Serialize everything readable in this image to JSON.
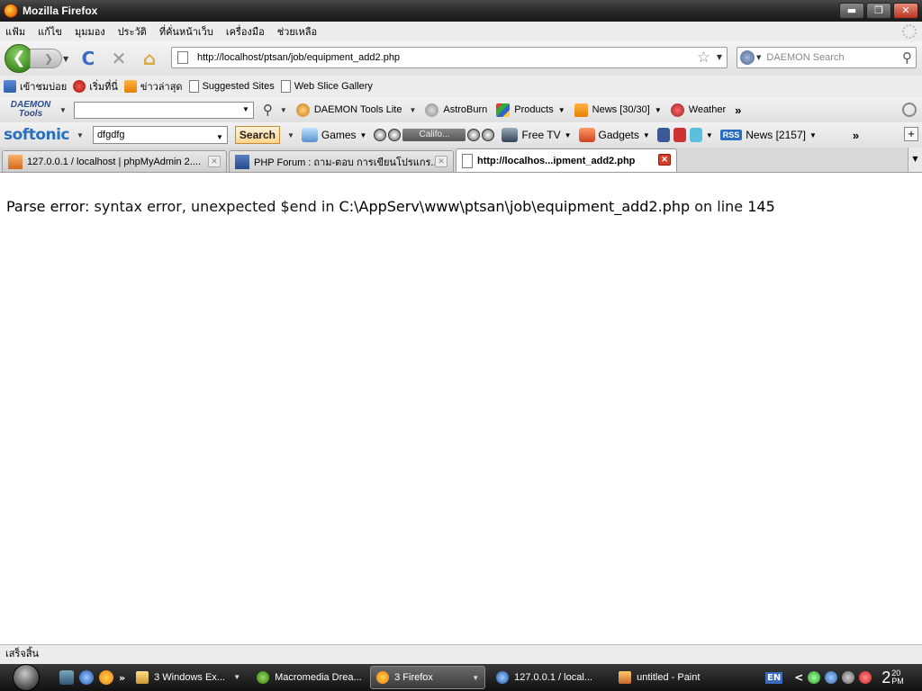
{
  "window": {
    "title": "Mozilla Firefox",
    "min_glyph": "▬",
    "max_glyph": "❐",
    "close_glyph": "✕"
  },
  "menubar": {
    "items": [
      "แฟ้ม",
      "แก้ไข",
      "มุมมอง",
      "ประวัติ",
      "ที่คั่นหน้าเว็บ",
      "เครื่องมือ",
      "ช่วยเหลือ"
    ]
  },
  "navbar": {
    "back_glyph": "❮",
    "forward_glyph": "❯",
    "reload_glyph": "C",
    "stop_glyph": "✕",
    "home_glyph": "⌂",
    "url": "http://localhost/ptsan/job/equipment_add2.php",
    "star_glyph": "☆",
    "search_placeholder": "DAEMON Search",
    "magnifier_glyph": "⚲"
  },
  "bookmarks": {
    "items": [
      {
        "label": "เข้าชมบ่อย",
        "icon": "most-visited-icon"
      },
      {
        "label": "เริ่มที่นี่",
        "icon": "getting-started-icon"
      },
      {
        "label": "ข่าวล่าสุด",
        "icon": "rss-icon"
      },
      {
        "label": "Suggested Sites",
        "icon": "page-icon"
      },
      {
        "label": "Web Slice Gallery",
        "icon": "page-icon"
      }
    ]
  },
  "daemon_toolbar": {
    "logo_line1": "DAEMON",
    "logo_line2": "Tools",
    "items": [
      {
        "label": "DAEMON Tools Lite",
        "icon": "daemon-icon"
      },
      {
        "label": "AstroBurn",
        "icon": "astroburn-icon"
      },
      {
        "label": "Products",
        "icon": "products-icon"
      },
      {
        "label": "News [30/30]",
        "icon": "rss-icon"
      },
      {
        "label": "Weather",
        "icon": "weather-icon"
      }
    ],
    "more_glyph": "»"
  },
  "softonic_toolbar": {
    "logo": "softonic",
    "search_value": "dfgdfg",
    "search_button": "Search",
    "games_label": "Games",
    "media_track": "Califo...",
    "free_tv_label": "Free TV",
    "gadgets_label": "Gadgets",
    "rss_badge": "RSS",
    "news_label": "News [2157]",
    "more_glyph": "»",
    "plus_glyph": "+"
  },
  "tabs": [
    {
      "label": "127.0.0.1 / localhost | phpMyAdmin 2....",
      "active": false
    },
    {
      "label": "PHP Forum : ถาม-ตอบ การเขียนโปรแกร...",
      "active": false
    },
    {
      "label": "http://localhos...ipment_add2.php",
      "active": true
    }
  ],
  "content": {
    "error_label": "Parse error",
    "error_message": ": syntax error, unexpected $end in ",
    "error_path": "C:\\AppServ\\www\\ptsan\\job\\equipment_add2.php",
    "error_on_line": " on line ",
    "error_line_number": "145"
  },
  "statusbar": {
    "text": "เสร็จสิ้น"
  },
  "taskbar": {
    "quick_more": "»",
    "tasks": [
      {
        "label": "3 Windows Ex...",
        "active": false,
        "dropdown": true
      },
      {
        "label": "Macromedia Drea...",
        "active": false,
        "dropdown": false
      },
      {
        "label": "3 Firefox",
        "active": true,
        "dropdown": true
      },
      {
        "label": "127.0.0.1 / local...",
        "active": false,
        "dropdown": false
      },
      {
        "label": "untitled - Paint",
        "active": false,
        "dropdown": false
      }
    ],
    "language": "EN",
    "tray_arrow": "<",
    "clock_hour": "2",
    "clock_minute": "20",
    "clock_ampm": "PM"
  }
}
